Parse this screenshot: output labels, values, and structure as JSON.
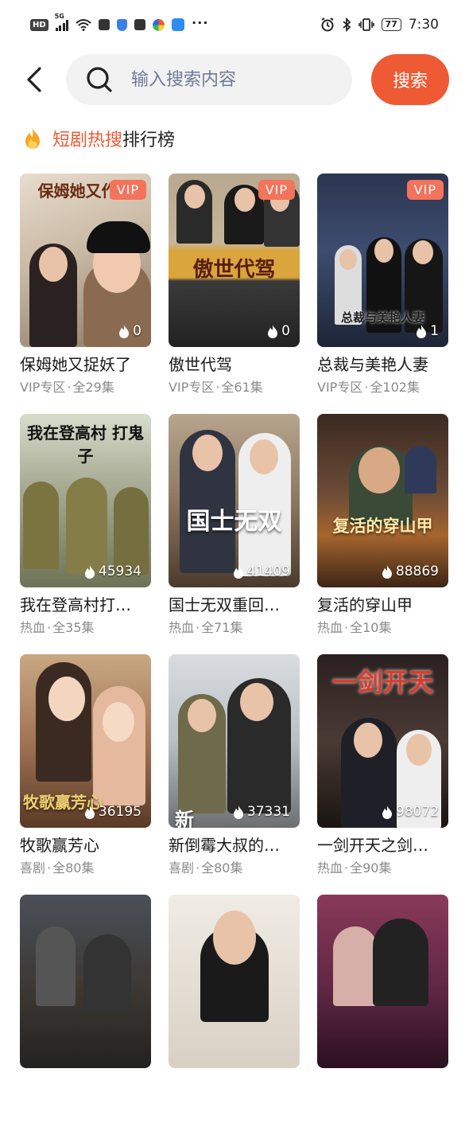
{
  "status_bar": {
    "left_badge": "HD",
    "network": "5G",
    "time": "7:30",
    "battery": "77",
    "more": "···",
    "icons": [
      "signal-icon",
      "wifi-icon",
      "message-icon",
      "shield-icon",
      "message-icon",
      "colorful-app-icon",
      "app-icon",
      "alarm-icon",
      "bluetooth-icon",
      "vibrate-icon",
      "battery-icon"
    ]
  },
  "search": {
    "placeholder": "输入搜索内容",
    "button_label": "搜索"
  },
  "ranking": {
    "title_highlight": "短剧热搜",
    "title_rest": "排行榜"
  },
  "colors": {
    "accent": "#ee5a34",
    "vip": "#f3735b",
    "meta": "#8a8a8a"
  },
  "cards": [
    {
      "title": "保姆她又捉妖了",
      "category": "VIP专区",
      "episodes": "全29集",
      "heat": "0",
      "vip": "VIP",
      "art": "保姆她又作妖"
    },
    {
      "title": "傲世代驾",
      "category": "VIP专区",
      "episodes": "全61集",
      "heat": "0",
      "vip": "VIP",
      "art": "傲世代驾"
    },
    {
      "title": "总裁与美艳人妻",
      "category": "VIP专区",
      "episodes": "全102集",
      "heat": "1",
      "vip": "VIP",
      "art": "总裁与美艳人妻"
    },
    {
      "title": "我在登高村打…",
      "category": "热血",
      "episodes": "全35集",
      "heat": "45934",
      "vip": "",
      "art": "我在登高村 打鬼子"
    },
    {
      "title": "国士无双重回…",
      "category": "热血",
      "episodes": "全71集",
      "heat": "41409",
      "vip": "",
      "art": "国士无双"
    },
    {
      "title": "复活的穿山甲",
      "category": "热血",
      "episodes": "全10集",
      "heat": "88869",
      "vip": "",
      "art": "复活的穿山甲"
    },
    {
      "title": "牧歌赢芳心",
      "category": "喜剧",
      "episodes": "全80集",
      "heat": "36195",
      "vip": "",
      "art": "牧歌赢芳心"
    },
    {
      "title": "新倒霉大叔的…",
      "category": "喜剧",
      "episodes": "全80集",
      "heat": "37331",
      "vip": "",
      "art": "新"
    },
    {
      "title": "一剑开天之剑…",
      "category": "热血",
      "episodes": "全90集",
      "heat": "98072",
      "vip": "",
      "art": "一剑开天"
    },
    {
      "title": "",
      "category": "",
      "episodes": "",
      "heat": "",
      "vip": "",
      "art": ""
    },
    {
      "title": "",
      "category": "",
      "episodes": "",
      "heat": "",
      "vip": "",
      "art": ""
    },
    {
      "title": "",
      "category": "",
      "episodes": "",
      "heat": "",
      "vip": "",
      "art": ""
    }
  ]
}
